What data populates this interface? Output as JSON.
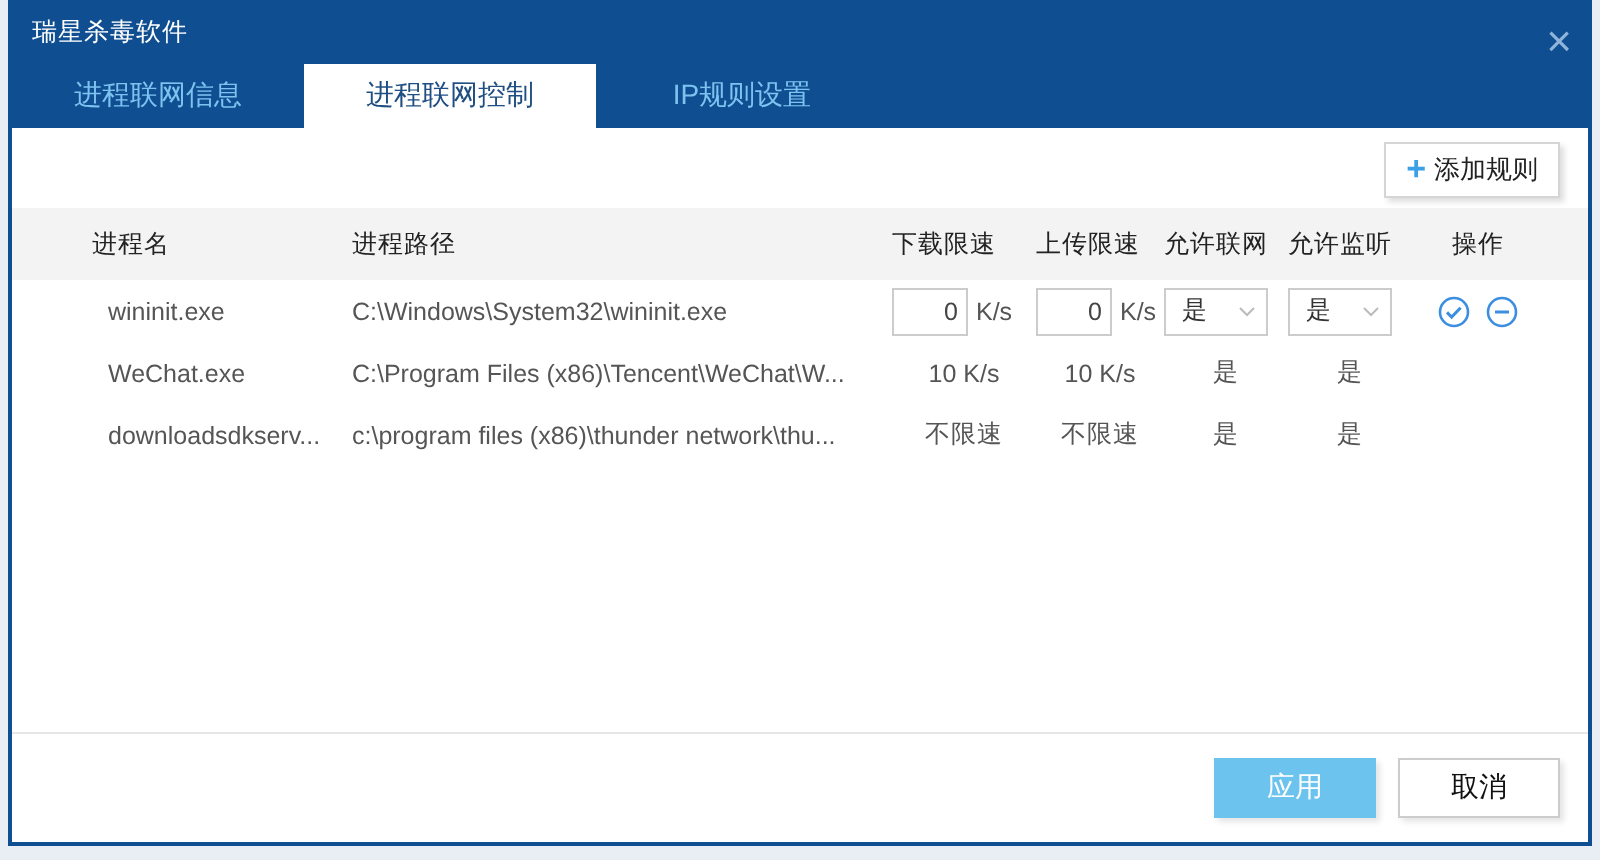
{
  "window": {
    "title": "瑞星杀毒软件",
    "close": "×"
  },
  "tabs": [
    {
      "label": "进程联网信息",
      "selected": false
    },
    {
      "label": "进程联网控制",
      "selected": true
    },
    {
      "label": "IP规则设置",
      "selected": false
    }
  ],
  "add_rule_button": {
    "icon": "+",
    "label": "添加规则"
  },
  "table": {
    "columns": [
      "进程名",
      "进程路径",
      "下载限速",
      "上传限速",
      "允许联网",
      "允许监听",
      "操作"
    ],
    "rows": [
      {
        "kind": "edit",
        "name": "wininit.exe",
        "path": "C:\\Windows\\System32\\wininit.exe",
        "download": "0",
        "download_unit": "K/s",
        "upload": "0",
        "upload_unit": "K/s",
        "allow_network": "是",
        "allow_listen": "是"
      },
      {
        "kind": "view",
        "name": "WeChat.exe",
        "path": "C:\\Program Files (x86)\\Tencent\\WeChat\\W...",
        "download": "10 K/s",
        "upload": "10 K/s",
        "allow_network": "是",
        "allow_listen": "是"
      },
      {
        "kind": "view",
        "name": "downloadsdkserv...",
        "path": "c:\\program files (x86)\\thunder network\\thu...",
        "download": "不限速",
        "upload": "不限速",
        "allow_network": "是",
        "allow_listen": "是"
      }
    ]
  },
  "buttons": [
    {
      "label": "应用",
      "disabled": true,
      "kind": "primary"
    },
    {
      "label": "取消",
      "disabled": false,
      "kind": "secondary"
    }
  ]
}
